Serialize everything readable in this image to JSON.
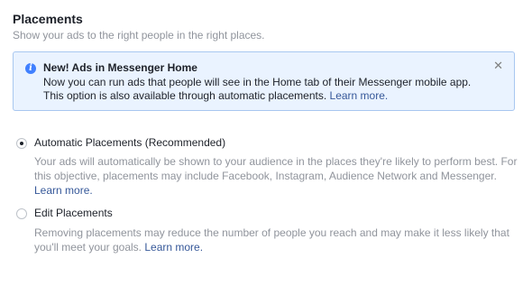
{
  "section": {
    "title": "Placements",
    "subtitle": "Show your ads to the right people in the right places."
  },
  "notice": {
    "icon": "info-icon",
    "title": "New! Ads in Messenger Home",
    "body": "Now you can run ads that people will see in the Home tab of their Messenger mobile app. This option is also available through automatic placements.",
    "link": "Learn more.",
    "close_icon": "close-icon"
  },
  "options": [
    {
      "label": "Automatic Placements (Recommended)",
      "selected": true,
      "description": "Your ads will automatically be shown to your audience in the places they're likely to perform best. For this objective, placements may include Facebook, Instagram, Audience Network and Messenger.",
      "link": "Learn more."
    },
    {
      "label": "Edit Placements",
      "selected": false,
      "description": "Removing placements may reduce the number of people you reach and may make it less likely that you'll meet your goals.",
      "link": "Learn more."
    }
  ],
  "colors": {
    "link": "#365899",
    "notice_bg": "#eaf3ff",
    "notice_border": "#a8c7f0",
    "info_icon": "#4080ff",
    "muted_text": "#90949c"
  }
}
